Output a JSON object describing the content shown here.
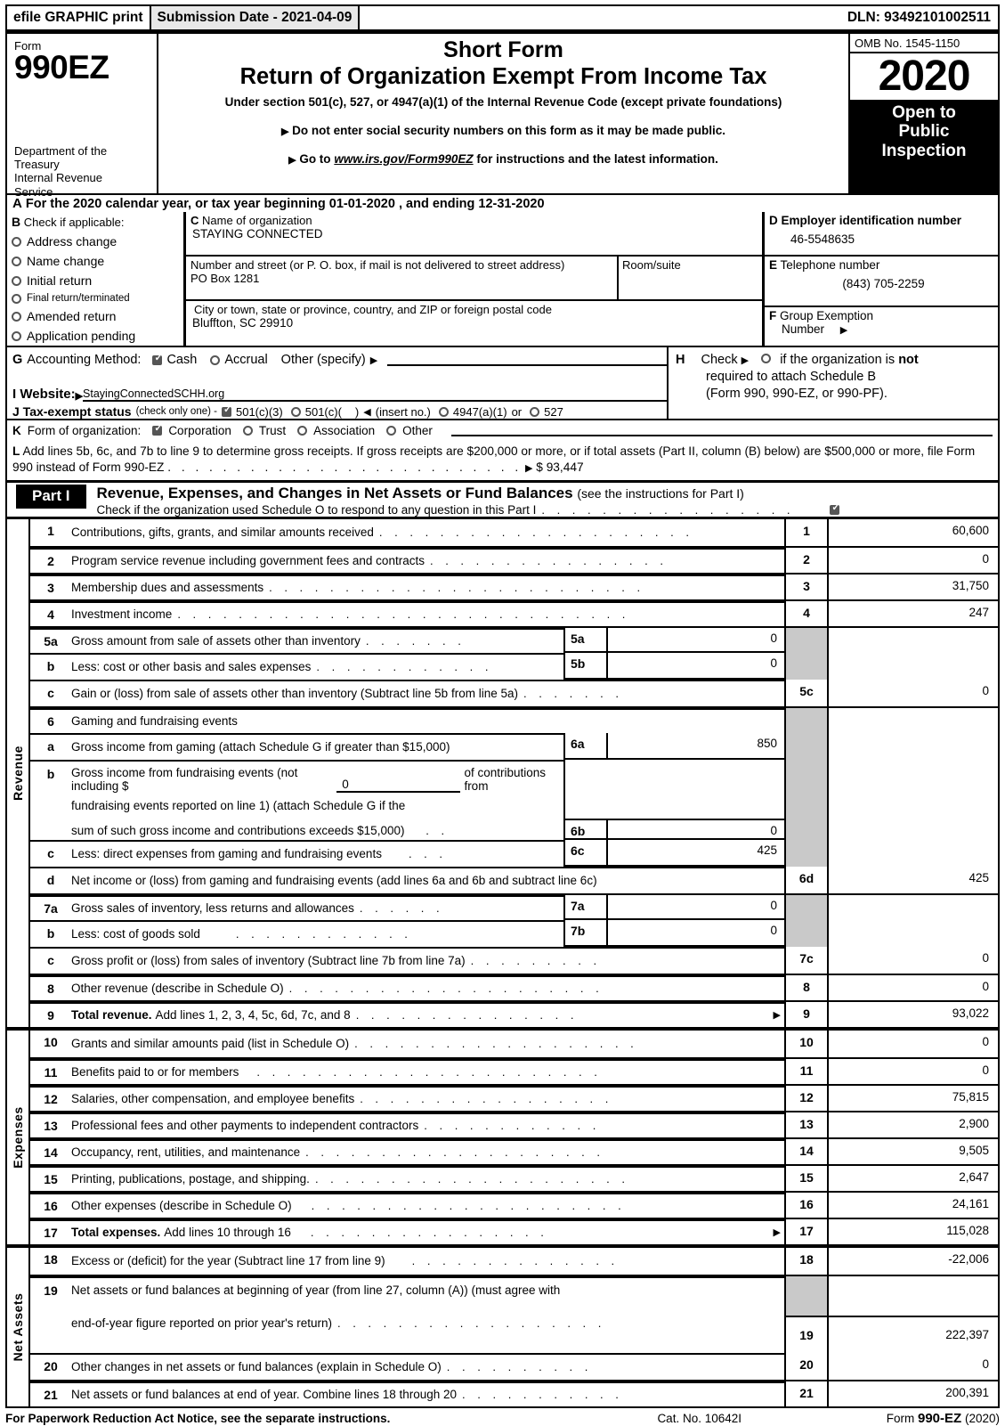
{
  "efile": {
    "print_label": "efile GRAPHIC print",
    "submission_date": "Submission Date - 2021-04-09",
    "dln": "DLN: 93492101002511"
  },
  "masthead": {
    "form_label": "Form",
    "form_number": "990EZ",
    "department": "Department of the Treasury\nInternal Revenue Service",
    "title_line1": "Short Form",
    "title_line2": "Return of Organization Exempt From Income Tax",
    "subtitle": "Under section 501(c), 527, or 4947(a)(1) of the Internal Revenue Code (except private foundations)",
    "bullet1": "Do not enter social security numbers on this form as it may be made public.",
    "bullet2_prefix": "Go to",
    "bullet2_link": "www.irs.gov/Form990EZ",
    "bullet2_suffix": "for instructions and the latest information.",
    "omb": "OMB No. 1545-1150",
    "year": "2020",
    "open_to_public": "Open to\nPublic\nInspection"
  },
  "line_a": {
    "letter": "A",
    "text": "For the 2020 calendar year, or tax year beginning 01-01-2020 , and ending 12-31-2020"
  },
  "section_b": {
    "letter": "B",
    "heading": "Check if applicable:",
    "items": [
      {
        "label": "Address change",
        "checked": false
      },
      {
        "label": "Name change",
        "checked": false
      },
      {
        "label": "Initial return",
        "checked": false
      },
      {
        "label": "Final return/terminated",
        "checked": false
      },
      {
        "label": "Amended return",
        "checked": false
      },
      {
        "label": "Application pending",
        "checked": false
      }
    ]
  },
  "section_c": {
    "letter": "C",
    "name_label": "Name of organization",
    "org_name": "STAYING CONNECTED",
    "street_label": "Number and street (or P. O. box, if mail is not delivered to street address)",
    "street_value": "PO Box 1281",
    "room_label": "Room/suite",
    "room_value": "",
    "city_label": "City or town, state or province, country, and ZIP or foreign postal code",
    "city_value": "Bluffton, SC   29910"
  },
  "section_d": {
    "letter": "D",
    "ein_label": "Employer identification number",
    "ein_value": "46-5548635",
    "letter_e": "E",
    "phone_label": "Telephone number",
    "phone_value": "(843) 705-2259",
    "letter_f": "F",
    "group_label": "Group Exemption",
    "group_label2": "Number"
  },
  "section_g": {
    "letter": "G",
    "label": "Accounting Method:",
    "cash": "Cash",
    "cash_checked": true,
    "accrual": "Accrual",
    "accrual_checked": false,
    "other": "Other (specify)",
    "other_value": ""
  },
  "section_h": {
    "letter": "H",
    "line1a": "Check",
    "line1b": "if the organization is",
    "line1c": "not",
    "line2": "required to attach Schedule B",
    "line3": "(Form 990, 990-EZ, or 990-PF).",
    "checked": false
  },
  "section_i": {
    "letter": "I Website:",
    "website": "StayingConnectedSCHH.org"
  },
  "section_j": {
    "letter": "J Tax-exempt status",
    "note": "(check only one) -",
    "opt1": "501(c)(3)",
    "opt1_checked": true,
    "opt2": "501(c)(",
    "opt2_checked": false,
    "opt2_tail": ")",
    "insert_no": "(insert no.)",
    "opt3": "4947(a)(1)",
    "opt3_checked": false,
    "or": "or",
    "opt4": "527",
    "opt4_checked": false
  },
  "section_k": {
    "letter": "K",
    "label": "Form of organization:",
    "options": [
      {
        "label": "Corporation",
        "checked": true
      },
      {
        "label": "Trust",
        "checked": false
      },
      {
        "label": "Association",
        "checked": false
      },
      {
        "label": "Other",
        "checked": false
      }
    ]
  },
  "section_l": {
    "letter": "L",
    "text": "Add lines 5b, 6c, and 7b to line 9 to determine gross receipts. If gross receipts are $200,000 or more, or if total assets (Part II, column (B) below) are $500,000 or more, file Form 990 instead of Form 990-EZ",
    "value": "$ 93,447"
  },
  "part_i": {
    "badge": "Part I",
    "title": "Revenue, Expenses, and Changes in Net Assets or Fund Balances",
    "title_note": "(see the instructions for Part I)",
    "schedule_o_text": "Check if the organization used Schedule O to respond to any question in this Part I",
    "schedule_o_checked": true
  },
  "revenue": {
    "sidebar_label": "Revenue",
    "lines": [
      {
        "num": "1",
        "desc": "Contributions, gifts, grants, and similar amounts received",
        "col": "1",
        "value": "60,600"
      },
      {
        "num": "2",
        "desc": "Program service revenue including government fees and contracts",
        "col": "2",
        "value": "0"
      },
      {
        "num": "3",
        "desc": "Membership dues and assessments",
        "col": "3",
        "value": "31,750"
      },
      {
        "num": "4",
        "desc": "Investment income",
        "col": "4",
        "value": "247"
      }
    ],
    "line5a": {
      "num": "5a",
      "desc": "Gross amount from sale of assets other than inventory",
      "box": "5a",
      "box_value": "0"
    },
    "line5b": {
      "num": "b",
      "desc": "Less: cost or other basis and sales expenses",
      "box": "5b",
      "box_value": "0"
    },
    "line5c": {
      "num": "c",
      "desc": "Gain or (loss) from sale of assets other than inventory (Subtract line 5b from line 5a)",
      "col": "5c",
      "value": "0"
    },
    "line6": {
      "num": "6",
      "desc": "Gaming and fundraising events"
    },
    "line6a": {
      "num": "a",
      "desc": "Gross income from gaming (attach Schedule G if greater than $15,000)",
      "box": "6a",
      "box_value": "850"
    },
    "line6b": {
      "num": "b",
      "desc_part1": "Gross income from fundraising events (not including $",
      "inline_value": "0",
      "desc_part2": "of contributions from",
      "desc_line2": "fundraising events reported on line 1) (attach Schedule G if the",
      "desc_line3": "sum of such gross income and contributions exceeds $15,000)",
      "box": "6b",
      "box_value": "0"
    },
    "line6c": {
      "num": "c",
      "desc": "Less: direct expenses from gaming and fundraising events",
      "box": "6c",
      "box_value": "425"
    },
    "line6d": {
      "num": "d",
      "desc": "Net income or (loss) from gaming and fundraising events (add lines 6a and 6b and subtract line 6c)",
      "col": "6d",
      "value": "425"
    },
    "line7a": {
      "num": "7a",
      "desc": "Gross sales of inventory, less returns and allowances",
      "box": "7a",
      "box_value": "0"
    },
    "line7b": {
      "num": "b",
      "desc": "Less: cost of goods sold",
      "box": "7b",
      "box_value": "0"
    },
    "line7c": {
      "num": "c",
      "desc": "Gross profit or (loss) from sales of inventory (Subtract line 7b from line 7a)",
      "col": "7c",
      "value": "0"
    },
    "line8": {
      "num": "8",
      "desc": "Other revenue (describe in Schedule O)",
      "col": "8",
      "value": "0"
    },
    "line9": {
      "num": "9",
      "desc_bold": "Total revenue.",
      "desc": "Add lines 1, 2, 3, 4, 5c, 6d, 7c, and 8",
      "col": "9",
      "value": "93,022"
    }
  },
  "expenses": {
    "sidebar_label": "Expenses",
    "lines": [
      {
        "num": "10",
        "desc": "Grants and similar amounts paid (list in Schedule O)",
        "col": "10",
        "value": "0"
      },
      {
        "num": "11",
        "desc": "Benefits paid to or for members",
        "col": "11",
        "value": "0"
      },
      {
        "num": "12",
        "desc": "Salaries, other compensation, and employee benefits",
        "col": "12",
        "value": "75,815"
      },
      {
        "num": "13",
        "desc": "Professional fees and other payments to independent contractors",
        "col": "13",
        "value": "2,900"
      },
      {
        "num": "14",
        "desc": "Occupancy, rent, utilities, and maintenance",
        "col": "14",
        "value": "9,505"
      },
      {
        "num": "15",
        "desc": "Printing, publications, postage, and shipping.",
        "col": "15",
        "value": "2,647"
      },
      {
        "num": "16",
        "desc": "Other expenses (describe in Schedule O)",
        "col": "16",
        "value": "24,161"
      }
    ],
    "line17": {
      "num": "17",
      "desc_bold": "Total expenses.",
      "desc": "Add lines 10 through 16",
      "col": "17",
      "value": "115,028"
    }
  },
  "net_assets": {
    "sidebar_label": "Net Assets",
    "line18": {
      "num": "18",
      "desc": "Excess or (deficit) for the year (Subtract line 17 from line 9)",
      "col": "18",
      "value": "-22,006"
    },
    "line19": {
      "num": "19",
      "desc_line1": "Net assets or fund balances at beginning of year (from line 27, column (A)) (must agree with",
      "desc_line2": "end-of-year figure reported on prior year's return)",
      "col": "19",
      "value": "222,397"
    },
    "line20": {
      "num": "20",
      "desc": "Other changes in net assets or fund balances (explain in Schedule O)",
      "col": "20",
      "value": "0"
    },
    "line21": {
      "num": "21",
      "desc": "Net assets or fund balances at end of year. Combine lines 18 through 20",
      "col": "21",
      "value": "200,391"
    }
  },
  "footer": {
    "notice": "For Paperwork Reduction Act Notice, see the separate instructions.",
    "cat_no": "Cat. No. 10642I",
    "form_label": "Form",
    "form_name": "990-EZ",
    "form_year": "(2020)"
  }
}
